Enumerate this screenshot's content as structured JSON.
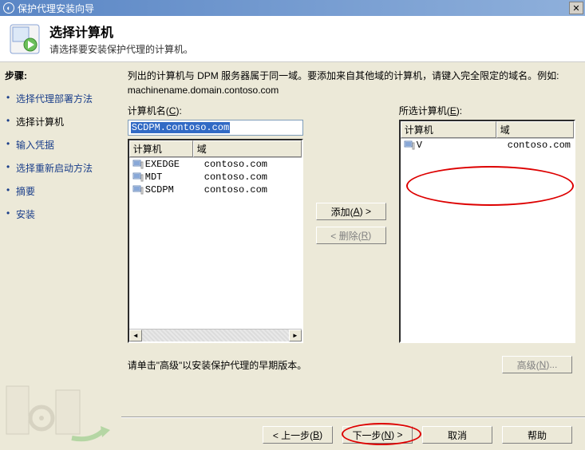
{
  "window": {
    "title": "保护代理安装向导"
  },
  "banner": {
    "heading": "选择计算机",
    "sub": "请选择要安装保护代理的计算机。"
  },
  "sidebar": {
    "header": "步骤:",
    "items": [
      {
        "label": "选择代理部署方法",
        "current": false
      },
      {
        "label": "选择计算机",
        "current": true
      },
      {
        "label": "输入凭据",
        "current": false
      },
      {
        "label": "选择重新启动方法",
        "current": false
      },
      {
        "label": "摘要",
        "current": false
      },
      {
        "label": "安装",
        "current": false
      }
    ]
  },
  "main": {
    "instruction": "列出的计算机与 DPM 服务器属于同一域。要添加来自其他域的计算机，请键入完全限定的域名。例如: machinename.domain.contoso.com",
    "left_label_html": "计算机名(C):",
    "left_label_ak": "C",
    "right_label_html": "所选计算机(E):",
    "right_label_ak": "E",
    "input_value": "SCDPM.contoso.com",
    "list_headers": {
      "name": "计算机",
      "domain": "域"
    },
    "available": [
      {
        "name": "EXEDGE",
        "domain": "contoso.com"
      },
      {
        "name": "MDT",
        "domain": "contoso.com"
      },
      {
        "name": "SCDPM",
        "domain": "contoso.com"
      }
    ],
    "selected": [
      {
        "name": "V",
        "domain": "contoso.com"
      }
    ],
    "add_label": "添加(A) >",
    "add_ak": "A",
    "remove_label": "< 删除(R)",
    "remove_ak": "R",
    "remove_disabled": true,
    "advanced_hint": "请单击\"高级\"以安装保护代理的早期版本。",
    "advanced_label": "高级(N)...",
    "advanced_ak": "N",
    "advanced_disabled": true
  },
  "buttons": {
    "back": "< 上一步(B)",
    "back_ak": "B",
    "next": "下一步(N) >",
    "next_ak": "N",
    "cancel": "取消",
    "help": "帮助"
  }
}
